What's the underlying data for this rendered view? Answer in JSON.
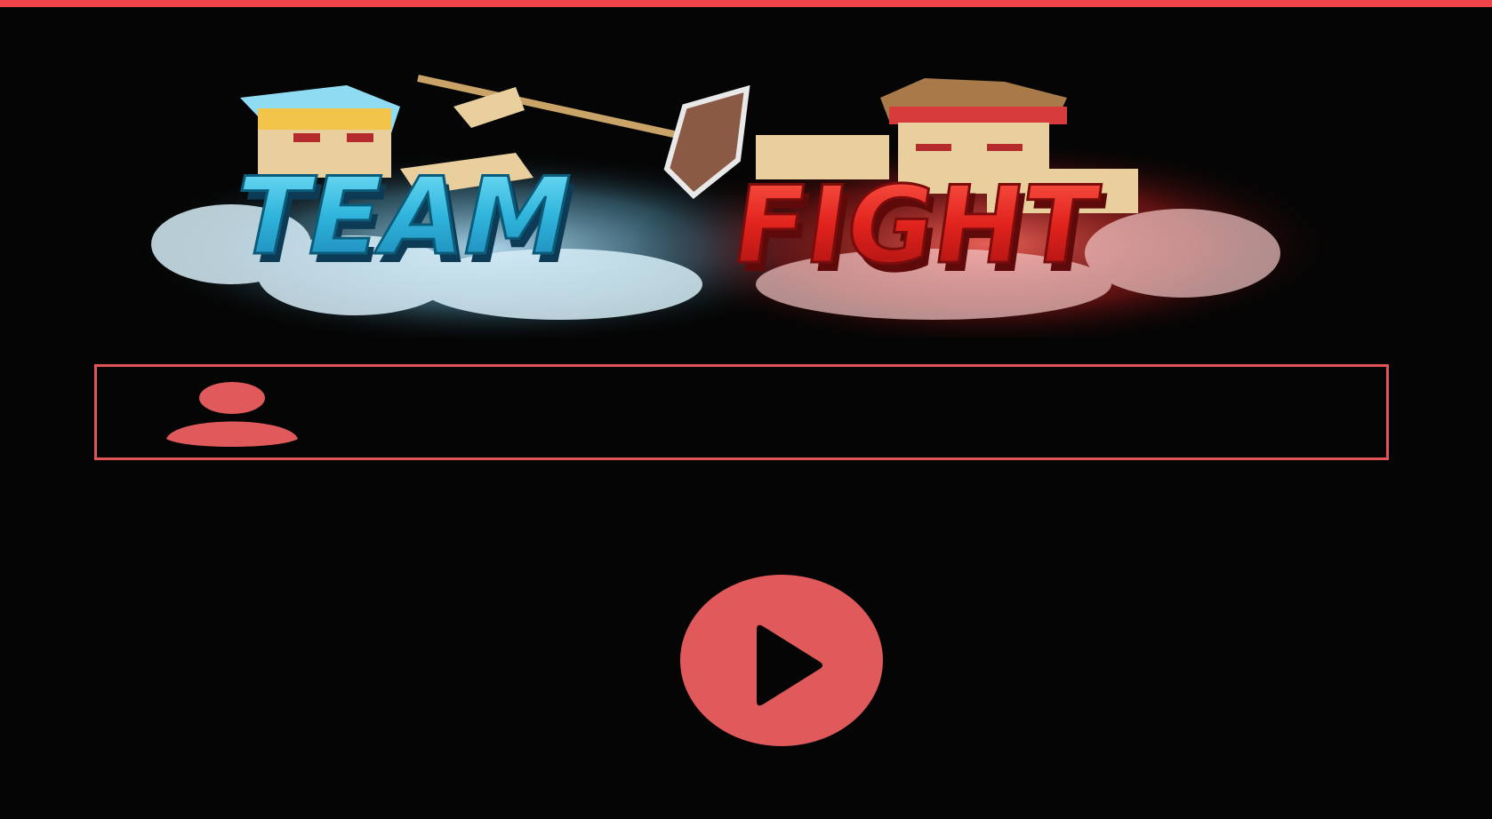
{
  "logo": {
    "word_left": "TEAM",
    "word_right": "FIGHT",
    "left_color": "#39c6e6",
    "right_color": "#e22a22"
  },
  "name_field": {
    "icon": "user-icon",
    "value": "",
    "placeholder": ""
  },
  "play_button": {
    "icon": "play-icon"
  },
  "colors": {
    "accent": "#e05a5c",
    "top_bar": "#f0434a",
    "background": "#050505"
  }
}
